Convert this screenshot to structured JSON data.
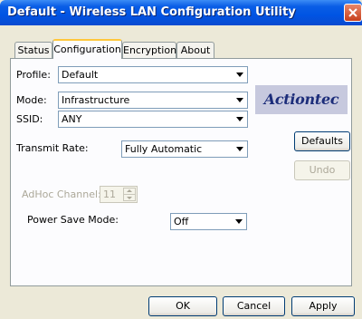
{
  "window": {
    "title": "Default - Wireless LAN Configuration Utility"
  },
  "tabs": [
    {
      "label": "Status",
      "active": false
    },
    {
      "label": "Configuration",
      "active": true
    },
    {
      "label": "Encryption",
      "active": false
    },
    {
      "label": "About",
      "active": false
    }
  ],
  "form": {
    "profile": {
      "label": "Profile:",
      "value": "Default"
    },
    "mode": {
      "label": "Mode:",
      "value": "Infrastructure"
    },
    "ssid": {
      "label": "SSID:",
      "value": "ANY"
    },
    "transmit_rate": {
      "label": "Transmit Rate:",
      "value": "Fully Automatic"
    },
    "adhoc_channel": {
      "label": "AdHoc Channel:",
      "value": "11",
      "enabled": false
    },
    "power_save": {
      "label": "Power Save Mode:",
      "value": "Off"
    }
  },
  "logo": {
    "text": "Actiontec"
  },
  "buttons": {
    "defaults": "Defaults",
    "undo": "Undo",
    "ok": "OK",
    "cancel": "Cancel",
    "apply": "Apply"
  },
  "colors": {
    "titlebar": "#0054e3",
    "tab_highlight": "#ffc73c",
    "logo_bg": "#c7c9de",
    "logo_text": "#1c2d7a"
  },
  "icons": {
    "close": "close-icon",
    "dropdown": "chevron-down-icon",
    "spinner": "spin-updown-icon"
  }
}
